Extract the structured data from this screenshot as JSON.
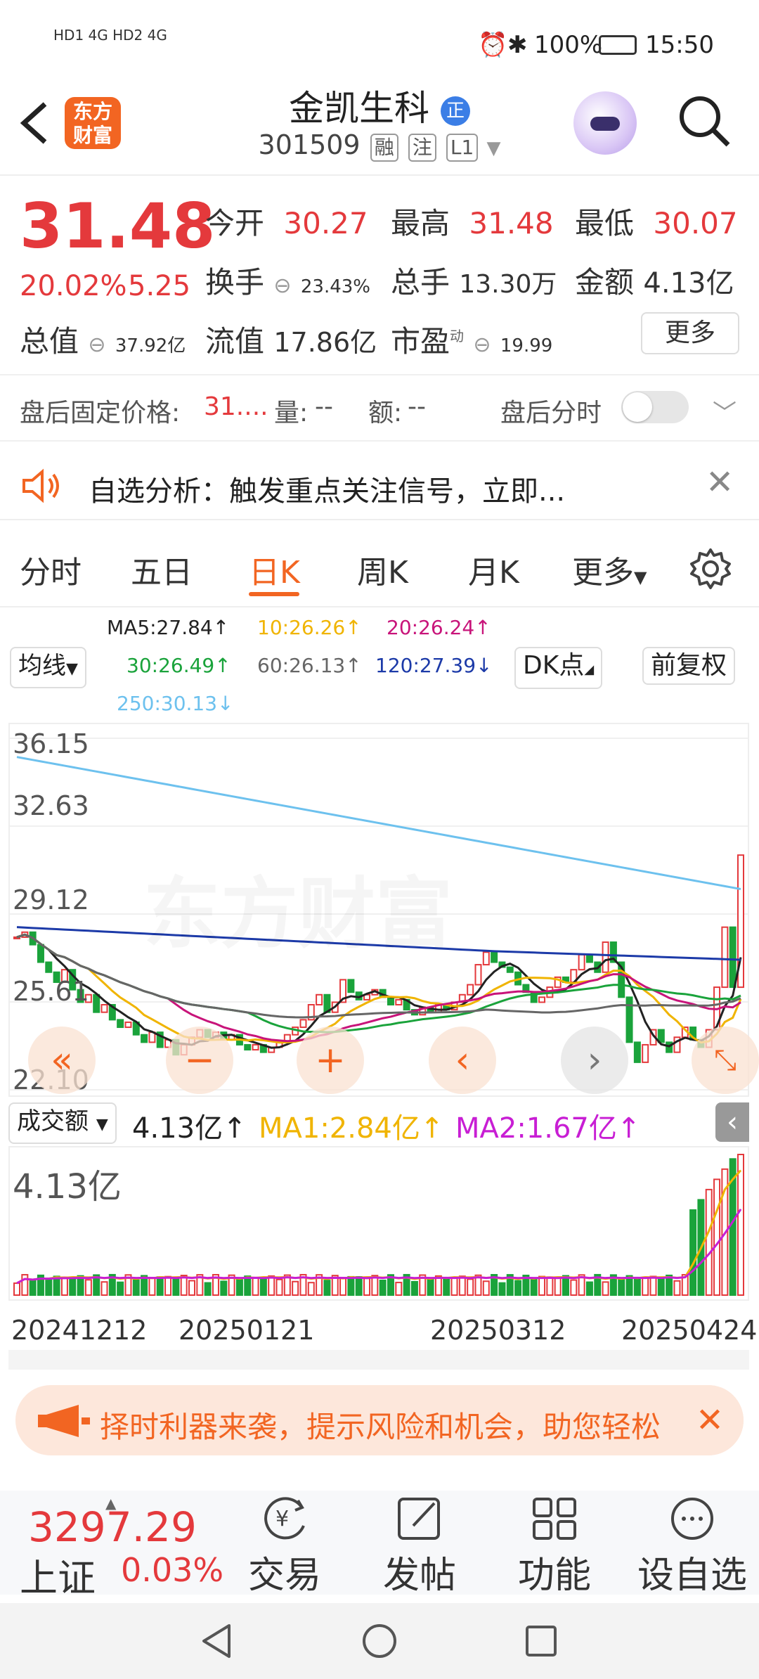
{
  "status": {
    "left": "HD1 4G HD2 4G",
    "battery": "100%",
    "time": "15:50"
  },
  "header": {
    "title": "金凯生科",
    "badge": "正",
    "code": "301509",
    "tags": [
      "融",
      "注",
      "L1"
    ],
    "logo_line1": "东方",
    "logo_line2": "财富"
  },
  "quote": {
    "price": "31.48",
    "change_pct": "20.02%",
    "change": "5.25",
    "open_label": "今开",
    "open": "30.27",
    "high_label": "最高",
    "high": "31.48",
    "low_label": "最低",
    "low": "30.07",
    "turnover_label": "换手",
    "turnover": "23.43%",
    "volume_label": "总手",
    "volume": "13.30万",
    "amount_label": "金额",
    "amount": "4.13亿",
    "mktcap_label": "总值",
    "mktcap": "37.92亿",
    "float_label": "流值",
    "float": "17.86亿",
    "pe_label": "市盈",
    "pe_sup": "动",
    "pe": "19.99",
    "more": "更多"
  },
  "after_hours": {
    "price_label": "盘后固定价格:",
    "price": "31....",
    "vol_label": "量:",
    "vol": "--",
    "amt_label": "额:",
    "amt": "--",
    "toggle_label": "盘后分时"
  },
  "notice": {
    "text": "自选分析：触发重点关注信号，立即..."
  },
  "tabs": [
    "分时",
    "五日",
    "日K",
    "周K",
    "月K",
    "更多"
  ],
  "active_tab": "日K",
  "ma": {
    "ma5": "MA5:27.84↑",
    "ma10": "10:26.26↑",
    "ma20": "20:26.24↑",
    "ma30": "30:26.49↑",
    "ma60": "60:26.13↑",
    "ma120": "120:27.39↓",
    "ma250": "250:30.13↓",
    "line_select": "均线",
    "dk": "DK点",
    "adjust": "前复权"
  },
  "colors": {
    "ma5": "#222222",
    "ma10": "#f0b400",
    "ma20": "#c8147a",
    "ma30": "#1aa33b",
    "ma60": "#666666",
    "ma120": "#1c3aa8",
    "ma250": "#6dc1ee",
    "up": "#e4393c",
    "down": "#1aa33b",
    "accent": "#f26522"
  },
  "chart_data": {
    "type": "candlestick",
    "y_ticks": [
      "36.15",
      "32.63",
      "29.12",
      "25.61",
      "22.10"
    ],
    "ylim": [
      22.1,
      36.15
    ],
    "x_labels": [
      "20241212",
      "20250121",
      "20250312",
      "20250424"
    ],
    "last_close": 31.48
  },
  "volume": {
    "selector": "成交额",
    "value": "4.13亿",
    "ma1": "MA1:2.84亿",
    "ma2": "MA2:1.67亿",
    "axis_label": "4.13亿"
  },
  "banner": {
    "text": "择时利器来袭，提示风险和机会，助您轻松"
  },
  "bottom": {
    "index_value": "3297.29",
    "index_name": "上证",
    "index_pct": "0.03%",
    "items": [
      "交易",
      "发帖",
      "功能",
      "设自选"
    ]
  }
}
